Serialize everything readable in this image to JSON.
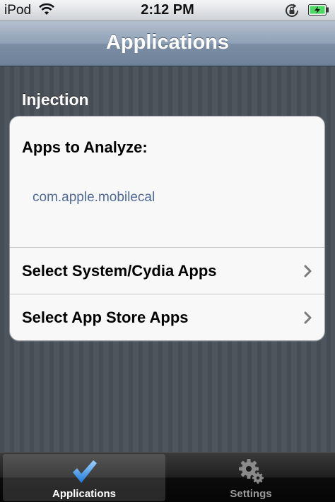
{
  "status_bar": {
    "carrier": "iPod",
    "time": "2:12 PM"
  },
  "nav_bar": {
    "title": "Applications"
  },
  "section": {
    "header": "Injection",
    "apps_to_analyze": {
      "title": "Apps to Analyze:",
      "value": "com.apple.mobilecal"
    },
    "rows": [
      {
        "label": "Select System/Cydia Apps"
      },
      {
        "label": "Select App Store Apps"
      }
    ]
  },
  "tab_bar": {
    "tabs": [
      {
        "label": "Applications",
        "selected": true,
        "icon": "checkmark-icon"
      },
      {
        "label": "Settings",
        "selected": false,
        "icon": "gear-icon"
      }
    ]
  },
  "colors": {
    "nav_bar": "#7c8ea4",
    "link_value": "#4f6a96",
    "battery_fill": "#4cd964",
    "tab_icon_selected": "#3c8fe8"
  }
}
